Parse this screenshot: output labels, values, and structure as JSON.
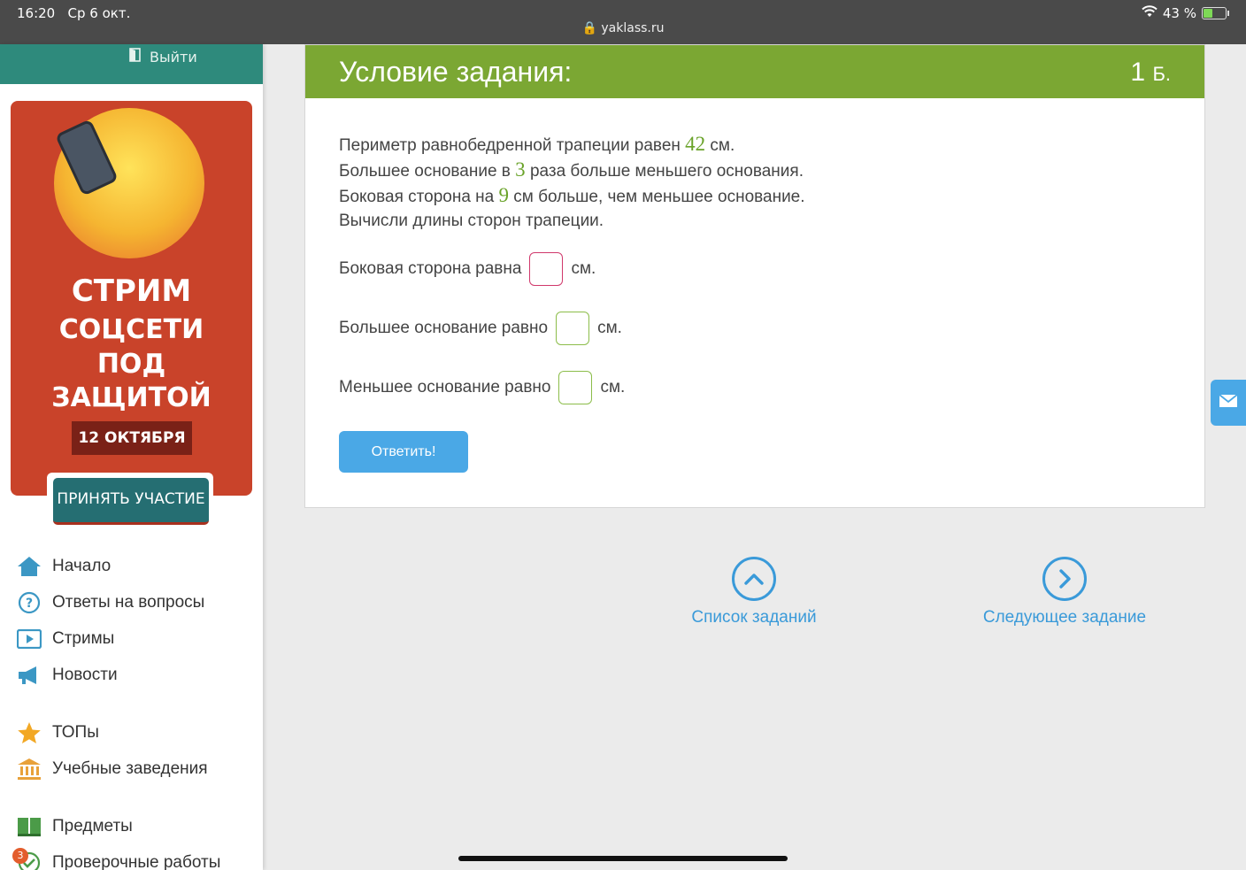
{
  "status_bar": {
    "time": "16:20",
    "date": "Ср 6 окт.",
    "url": "yaklass.ru",
    "battery": "43 %"
  },
  "sidebar": {
    "logout": "Выйти",
    "promo": {
      "title1": "СТРИМ",
      "title2": "СОЦСЕТИ",
      "title3": "ПОД",
      "title4": "ЗАЩИТОЙ",
      "date": "12 ОКТЯБРЯ",
      "button": "ПРИНЯТЬ УЧАСТИЕ"
    },
    "nav": [
      {
        "label": "Начало",
        "icon": "home-icon"
      },
      {
        "label": "Ответы на вопросы",
        "icon": "question-icon"
      },
      {
        "label": "Стримы",
        "icon": "play-icon"
      },
      {
        "label": "Новости",
        "icon": "megaphone-icon"
      },
      {
        "label": "ТОПы",
        "icon": "star-icon"
      },
      {
        "label": "Учебные заведения",
        "icon": "building-icon"
      },
      {
        "label": "Предметы",
        "icon": "book-icon"
      },
      {
        "label": "Проверочные работы",
        "icon": "check-icon"
      }
    ],
    "badge_count": "3"
  },
  "task": {
    "title": "Условие задания:",
    "points": "1",
    "points_unit": "Б.",
    "problem": {
      "l1_a": "Периметр равнобедренной трапеции равен ",
      "l1_num": "42",
      "l1_b": " см.",
      "l2_a": "Большее основание в ",
      "l2_num": "3",
      "l2_b": " раза больше меньшего основания.",
      "l3_a": "Боковая сторона на ",
      "l3_num": "9",
      "l3_b": " см больше, чем меньшее основание.",
      "l4": "Вычисли длины сторон трапеции."
    },
    "answers": [
      {
        "label": "Боковая сторона равна",
        "unit": "см.",
        "value": ""
      },
      {
        "label": "Большее основание равно",
        "unit": "см.",
        "value": ""
      },
      {
        "label": "Меньшее основание равно",
        "unit": "см.",
        "value": ""
      }
    ],
    "submit": "Ответить!"
  },
  "footer_nav": {
    "list": "Список заданий",
    "next": "Следующее задание"
  },
  "colors": {
    "accent_green": "#7ba733",
    "accent_blue": "#4aa8e6",
    "sidebar_teal": "#2e8a7c"
  }
}
